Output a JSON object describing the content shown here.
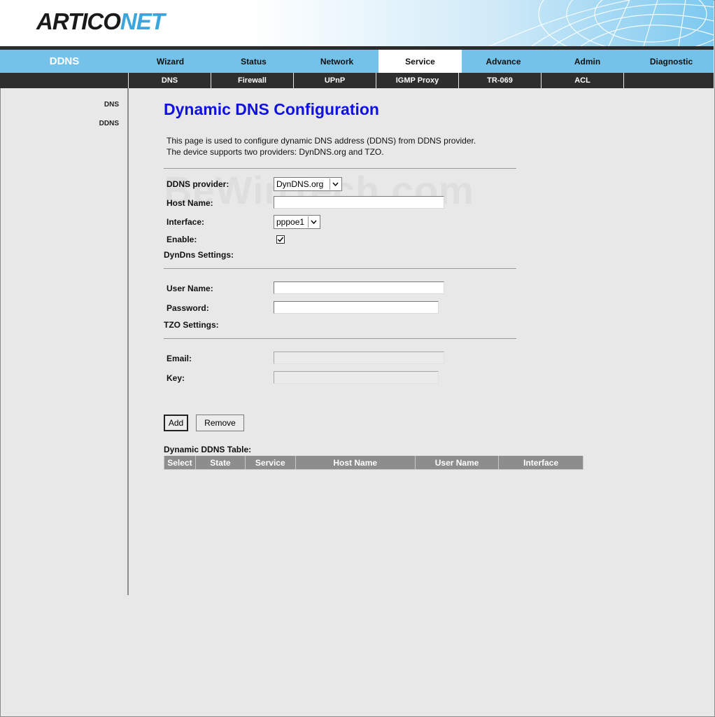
{
  "brand": {
    "logo_part1": "ARTICO",
    "logo_part2": "NET"
  },
  "nav": {
    "section_title": "DDNS",
    "tabs": [
      {
        "label": "Wizard"
      },
      {
        "label": "Status"
      },
      {
        "label": "Network"
      },
      {
        "label": "Service",
        "active": true
      },
      {
        "label": "Advance"
      },
      {
        "label": "Admin"
      },
      {
        "label": "Diagnostic"
      }
    ],
    "subtabs": [
      {
        "label": "DNS"
      },
      {
        "label": "Firewall"
      },
      {
        "label": "UPnP"
      },
      {
        "label": "IGMP Proxy"
      },
      {
        "label": "TR-069"
      },
      {
        "label": "ACL"
      }
    ]
  },
  "sidebar": {
    "items": [
      {
        "label": "DNS"
      },
      {
        "label": "DDNS"
      }
    ]
  },
  "page": {
    "title": "Dynamic DNS Configuration",
    "description_line1": "This page is used to configure dynamic DNS address (DDNS) from DDNS provider.",
    "description_line2": "The device supports two providers: DynDNS.org and TZO.",
    "watermark": "BeWinTech.com"
  },
  "form": {
    "provider_label": "DDNS provider:",
    "provider_value": "DynDNS.org",
    "hostname_label": "Host Name:",
    "hostname_value": "",
    "interface_label": "Interface:",
    "interface_value": "pppoe1",
    "enable_label": "Enable:",
    "enable_checked": true,
    "dyndns_section": "DynDns Settings:",
    "username_label": "User Name:",
    "username_value": "",
    "password_label": "Password:",
    "password_value": "",
    "tzo_section": "TZO Settings:",
    "email_label": "Email:",
    "email_value": "",
    "key_label": "Key:",
    "key_value": ""
  },
  "buttons": {
    "add": "Add",
    "remove": "Remove"
  },
  "table": {
    "title": "Dynamic DDNS Table:",
    "columns": [
      "Select",
      "State",
      "Service",
      "Host Name",
      "User Name",
      "Interface"
    ]
  },
  "colors": {
    "nav_bg": "#74c2ea",
    "subnav_bg": "#2e2e2e",
    "title_blue": "#1010e0",
    "logo_blue": "#3aa6dc"
  },
  "icons": {
    "dropdown": "chevron-down-icon",
    "check": "checkmark-icon"
  }
}
